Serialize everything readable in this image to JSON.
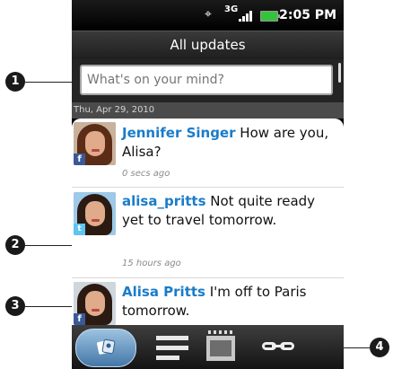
{
  "status": {
    "gps_icon": "gps-icon",
    "network": "3G",
    "time": "2:05 PM"
  },
  "header": {
    "title": "All updates"
  },
  "composer": {
    "placeholder": "What's on your mind?"
  },
  "date_header": "Thu, Apr 29, 2010",
  "posts": [
    {
      "name": "Jennifer Singer",
      "text": " How are you, Alisa?",
      "time": "0 secs ago",
      "service": "facebook"
    },
    {
      "name": "alisa_pritts",
      "text": " Not quite ready yet to travel tomorrow.",
      "time": "15 hours ago",
      "service": "twitter"
    },
    {
      "name": "Alisa Pritts",
      "text": " I'm off to Paris tomorrow.",
      "time": "",
      "service": "facebook"
    }
  ],
  "badges": {
    "facebook": "f",
    "twitter": "t"
  },
  "tabs": [
    "updates-icon",
    "status-list-icon",
    "photos-icon",
    "links-icon"
  ],
  "callouts": [
    "1",
    "2",
    "3",
    "4"
  ]
}
